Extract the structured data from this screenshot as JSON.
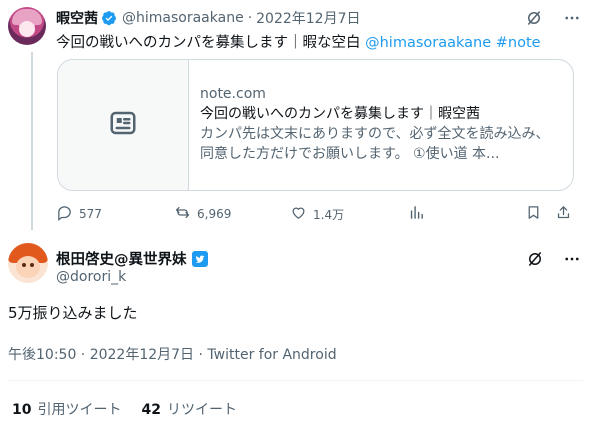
{
  "parent_tweet": {
    "author_name": "暇空茜",
    "handle": "@himasoraakane",
    "separator": "·",
    "date": "2022年12月7日",
    "text": "今回の戦いへのカンパを募集します｜暇な空白 ",
    "mention": "@himasoraakane",
    "hashtag": "#note",
    "card": {
      "domain": "note.com",
      "title": "今回の戦いへのカンパを募集します｜暇空茜",
      "description": "カンパ先は文末にありますので、必ず全文を読み込み、同意した方だけでお願いします。 ①使い道 本..."
    },
    "actions": {
      "replies": "577",
      "retweets": "6,969",
      "likes": "1.4万"
    },
    "icons": [
      "verified-icon",
      "grok-icon",
      "more-icon",
      "reply-icon",
      "retweet-icon",
      "like-icon",
      "views-icon",
      "bookmark-icon",
      "share-icon",
      "article-icon"
    ]
  },
  "main_tweet": {
    "author_name": "根田啓史@異世界妹",
    "handle": "@dorori_k",
    "text": "5万振り込みました",
    "meta": "午後10:50 · 2022年12月7日 · Twitter for Android",
    "stats": {
      "quote_count": "10",
      "quote_label": "引用ツイート",
      "retweet_count": "42",
      "retweet_label": "リツイート"
    }
  },
  "colors": {
    "accent": "#1d9bf0",
    "text": "#0f1419",
    "muted": "#536471",
    "border": "#cfd9de"
  }
}
